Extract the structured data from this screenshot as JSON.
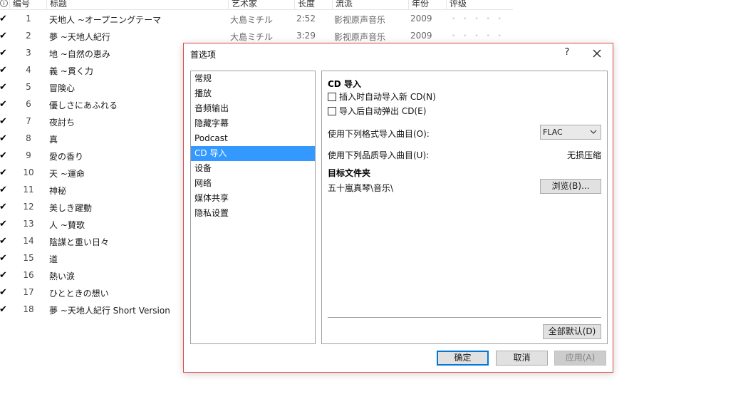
{
  "track_list": {
    "columns": {
      "info_icon": "i",
      "number": "编号",
      "title": "标题",
      "artist": "艺术家",
      "length": "长度",
      "genre": "流派",
      "year": "年份",
      "rating": "评级"
    },
    "check_glyph": "✔",
    "rating_glyph": "• • • • •",
    "tracks": [
      {
        "num": "1",
        "title": "天地人 ~オープニングテーマ",
        "artist": "大島ミチル",
        "length": "2:52",
        "genre": "影视原声音乐",
        "year": "2009"
      },
      {
        "num": "2",
        "title": "夢 ~天地人紀行",
        "artist": "大島ミチル",
        "length": "3:29",
        "genre": "影视原声音乐",
        "year": "2009"
      },
      {
        "num": "3",
        "title": "地 ~自然の恵み"
      },
      {
        "num": "4",
        "title": "義 ~貫く力"
      },
      {
        "num": "5",
        "title": "冒険心"
      },
      {
        "num": "6",
        "title": "優しさにあふれる"
      },
      {
        "num": "7",
        "title": "夜討ち"
      },
      {
        "num": "8",
        "title": "真"
      },
      {
        "num": "9",
        "title": "愛の香り"
      },
      {
        "num": "10",
        "title": "天 ~運命"
      },
      {
        "num": "11",
        "title": "神秘"
      },
      {
        "num": "12",
        "title": "美しき躍動"
      },
      {
        "num": "13",
        "title": "人 ~賛歌"
      },
      {
        "num": "14",
        "title": "陰謀と重い日々"
      },
      {
        "num": "15",
        "title": "道"
      },
      {
        "num": "16",
        "title": "熱い涙"
      },
      {
        "num": "17",
        "title": "ひとときの想い"
      },
      {
        "num": "18",
        "title": "夢 ~天地人紀行 Short Version"
      }
    ]
  },
  "dialog": {
    "title": "首选项",
    "help_label": "?",
    "close_icon": "close-icon",
    "nav_items": [
      "常规",
      "播放",
      "音频输出",
      "隐藏字幕",
      "Podcast",
      "CD 导入",
      "设备",
      "网络",
      "媒体共享",
      "隐私设置"
    ],
    "active_nav": "CD 导入",
    "cd_import": {
      "section_title": "CD 导入",
      "auto_import_label": "插入时自动导入新 CD(N)",
      "auto_import_checked": false,
      "auto_eject_label": "导入后自动弹出 CD(E)",
      "auto_eject_checked": false,
      "format_label": "使用下列格式导入曲目(O):",
      "format_value": "FLAC",
      "quality_label": "使用下列品质导入曲目(U):",
      "quality_value": "无损压缩",
      "folder_title": "目标文件夹",
      "folder_path": "五十嵐真琴\\音乐\\",
      "browse_label": "浏览(B)...",
      "defaults_label": "全部默认(D)"
    },
    "ok_label": "确定",
    "cancel_label": "取消",
    "apply_label": "应用(A)"
  }
}
